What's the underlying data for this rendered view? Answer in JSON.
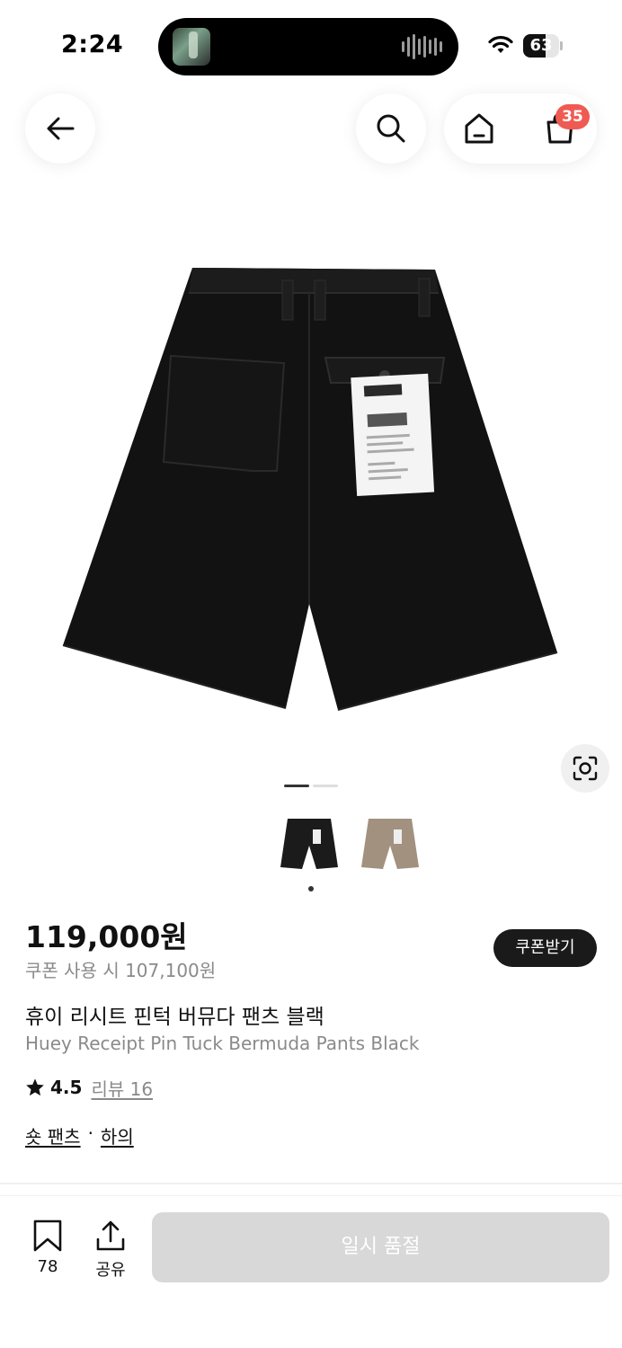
{
  "status": {
    "time": "2:24",
    "battery": "63",
    "battery_level": 0.63
  },
  "nav": {
    "icons": [
      "back-arrow-icon",
      "search-icon",
      "home-icon",
      "shopping-bag-icon"
    ],
    "cart_count": "35"
  },
  "gallery": {
    "current_index": 1,
    "total": 2,
    "thumbnails": [
      "black",
      "beige"
    ],
    "colors": {
      "black": "#1b1b1b",
      "beige": "#a2917f"
    }
  },
  "product": {
    "price": "119,000원",
    "coupon_price": "쿠폰 사용 시 107,100원",
    "coupon_button": "쿠폰받기",
    "name_ko": "휴이 리시트 핀턱 버뮤다 팬츠 블랙",
    "name_en": "Huey Receipt Pin Tuck Bermuda Pants Black",
    "rating": "4.5",
    "review_label": "리뷰 16",
    "categories": [
      "숏 팬츠",
      "하의"
    ],
    "category_separator": "·"
  },
  "bottom_bar": {
    "like_count": "78",
    "share_label": "공유",
    "soldout_label": "일시 품절"
  },
  "colors": {
    "badge": "#ef5b52",
    "coupon_button_bg": "#1a1a1a",
    "soldout_bg": "#d8d8d8"
  }
}
